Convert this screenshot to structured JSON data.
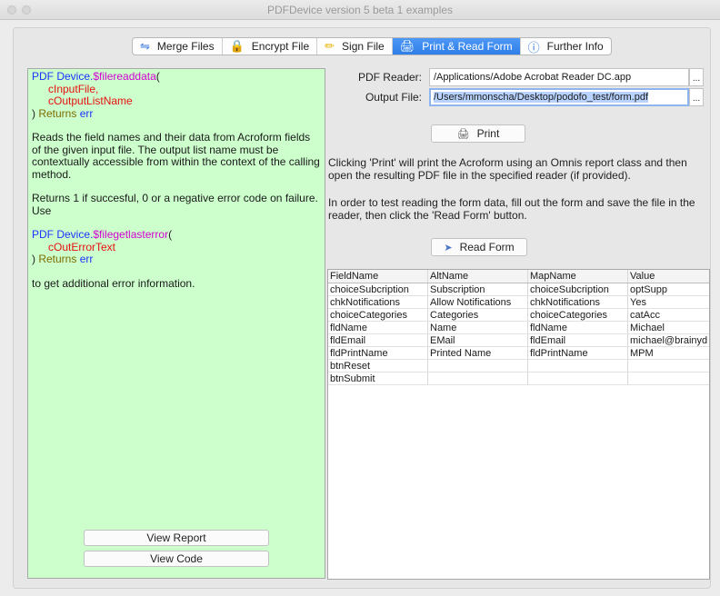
{
  "window": {
    "title": "PDFDevice version 5 beta 1 examples"
  },
  "tabs": [
    {
      "icon": "merge-icon",
      "label": "Merge Files",
      "active": false
    },
    {
      "icon": "lock-icon",
      "label": "Encrypt File",
      "active": false
    },
    {
      "icon": "pen-icon",
      "label": "Sign File",
      "active": false
    },
    {
      "icon": "printer-icon",
      "label": "Print & Read Form",
      "active": true
    },
    {
      "icon": "info-icon",
      "label": "Further Info",
      "active": false
    }
  ],
  "help": {
    "sig1": {
      "object": "PDF Device.",
      "method": "$filereaddata",
      "open": "(",
      "param1": "cInputFile,",
      "param2": "cOutputListName",
      "close": ")",
      "returns": " Returns ",
      "ret": "err"
    },
    "para1": "Reads the field names and their data from Acroform fields of the given input file. The output list name must be contextually accessible from within the context of the calling method.",
    "para2": "Returns 1 if succesful, 0 or a negative error code on failure. Use",
    "sig2": {
      "object": "PDF Device.",
      "method": "$filegetlasterror",
      "open": "(",
      "param1": "cOutErrorText",
      "close": ")",
      "returns": " Returns ",
      "ret": "err"
    },
    "para3": "to get additional error information.",
    "view_report": "View Report",
    "view_code": "View Code"
  },
  "form": {
    "pdf_reader_label": "PDF Reader:",
    "pdf_reader_value": "/Applications/Adobe Acrobat Reader DC.app",
    "output_file_label": "Output File:",
    "output_file_value": "/Users/mmonscha/Desktop/podofo_test/form.pdf",
    "ellipsis": "...",
    "print_label": "Print",
    "desc1": "Clicking 'Print' will print the Acroform using an Omnis report class and then open the resulting PDF file in the specified reader (if provided).",
    "desc2": "In order to test reading the form data, fill out the form and save the file in the reader, then click the 'Read Form' button.",
    "read_form_label": "Read Form"
  },
  "table": {
    "columns": [
      "FieldName",
      "AltName",
      "MapName",
      "Value"
    ],
    "rows": [
      [
        "choiceSubcription",
        "Subscription",
        "choiceSubcription",
        "optSupp"
      ],
      [
        "chkNotifications",
        "Allow Notifications",
        "chkNotifications",
        "Yes"
      ],
      [
        "choiceCategories",
        "Categories",
        "choiceCategories",
        "catAcc"
      ],
      [
        "fldName",
        "Name",
        "fldName",
        "Michael"
      ],
      [
        "fldEmail",
        "EMail",
        "fldEmail",
        "michael@brainyd"
      ],
      [
        "fldPrintName",
        "Printed Name",
        "fldPrintName",
        "MPM"
      ],
      [
        "btnReset",
        "",
        "",
        ""
      ],
      [
        "btnSubmit",
        "",
        "",
        ""
      ]
    ]
  },
  "colors": {
    "accent": "#2f7ee8",
    "help_bg": "#ccffcc"
  }
}
